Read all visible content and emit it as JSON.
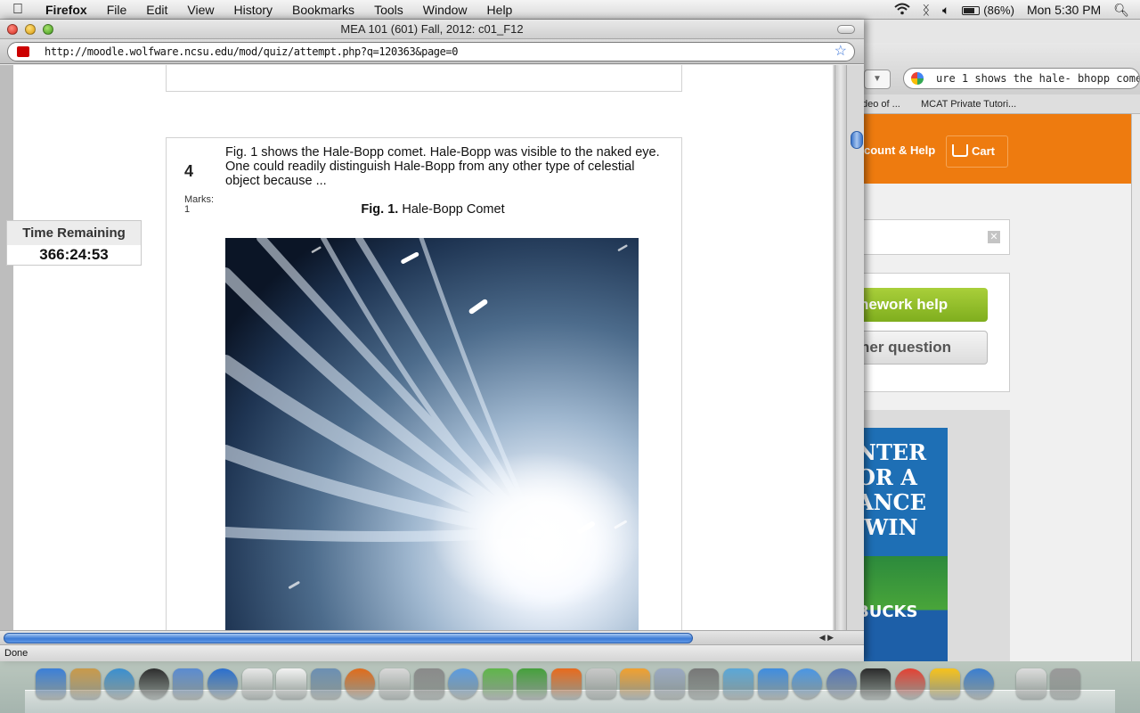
{
  "menubar": {
    "app_name": "Firefox",
    "menus": [
      "File",
      "Edit",
      "View",
      "History",
      "Bookmarks",
      "Tools",
      "Window",
      "Help"
    ],
    "battery_percent": "(86%)",
    "clock": "Mon 5:30 PM"
  },
  "window": {
    "title": "MEA 101 (601) Fall, 2012: c01_F12",
    "url": "http://moodle.wolfware.ncsu.edu/mod/quiz/attempt.php?q=120363&page=0",
    "status": "Done"
  },
  "timer": {
    "label": "Time Remaining",
    "value": "366:24:53"
  },
  "question": {
    "number": "4",
    "marks_label": "Marks:",
    "marks_value": "1",
    "text": "Fig. 1 shows the Hale-Bopp comet. Hale-Bopp was visible to the naked eye. One could readily distinguish Hale-Bopp from any other type of celestial object because ...",
    "figure_label": "Fig. 1.",
    "figure_title": "Hale-Bopp Comet"
  },
  "background_browser": {
    "search_text": "ure 1 shows the hale- bhopp comet",
    "bookmarks": [
      "deo of ...",
      "MCAT Private Tutori..."
    ],
    "account_help": "count & Help",
    "cart": "Cart",
    "btn_homework": "nework help",
    "btn_question": "her question",
    "ad_text": "NTER\nOR A\nANCE\n WIN",
    "ad_bottom": "BUCKS"
  },
  "dock": {
    "icons": [
      "finder-icon",
      "address-book-icon",
      "safari-icon",
      "dashboard-icon",
      "mail-icon",
      "google-earth-icon",
      "ical-plus-icon",
      "ical-icon",
      "iphoto-icon",
      "firefox-icon",
      "printer-icon",
      "system-preferences-icon",
      "ie-icon",
      "network-icon",
      "download-icon",
      "powerpoint-icon",
      "photo-icon",
      "keynote-icon",
      "office-icon",
      "installer-icon",
      "chart-icon",
      "messenger-icon",
      "messenger-icon-2",
      "spaces-icon",
      "printer-2-icon",
      "chrome-icon",
      "aim-icon",
      "itunes-icon",
      "documents-icon",
      "trash-icon"
    ]
  }
}
